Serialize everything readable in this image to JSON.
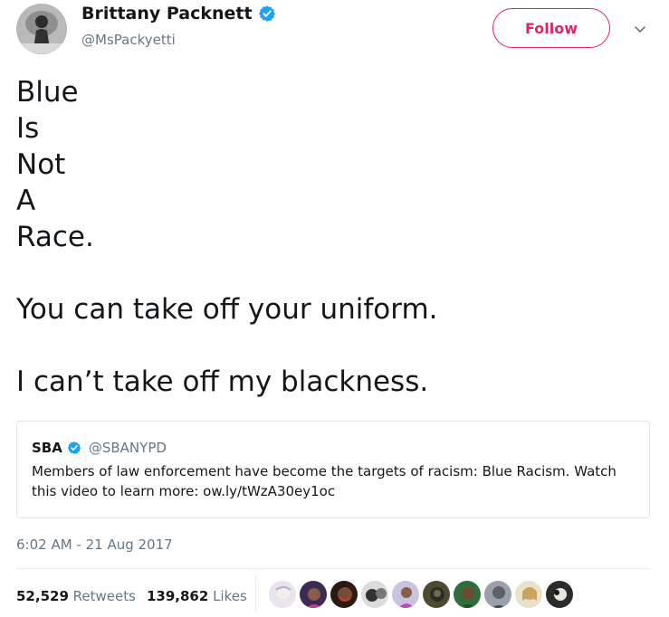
{
  "author": {
    "display_name": "Brittany Packnett",
    "handle": "@MsPackyetti",
    "verified_icon": "verified-badge-icon"
  },
  "follow_button": {
    "label": "Follow"
  },
  "tweet": {
    "lines": [
      "Blue",
      "Is",
      "Not",
      "A",
      "Race."
    ],
    "line2": "You can take off your uniform.",
    "line3": "I can’t take off my blackness."
  },
  "quote": {
    "name": "SBA",
    "handle": "@SBANYPD",
    "text": "Members of law enforcement have become the targets of racism: Blue Racism. Watch this video to learn more: ow.ly/tWzA30ey1oc"
  },
  "timestamp": "6:02 AM - 21 Aug 2017",
  "stats": {
    "retweets_count": "52,529",
    "retweets_label": "Retweets",
    "likes_count": "139,862",
    "likes_label": "Likes"
  },
  "colors": {
    "accent_like": "#e0245e",
    "verified_blue": "#1da1f2",
    "muted": "#657786"
  }
}
